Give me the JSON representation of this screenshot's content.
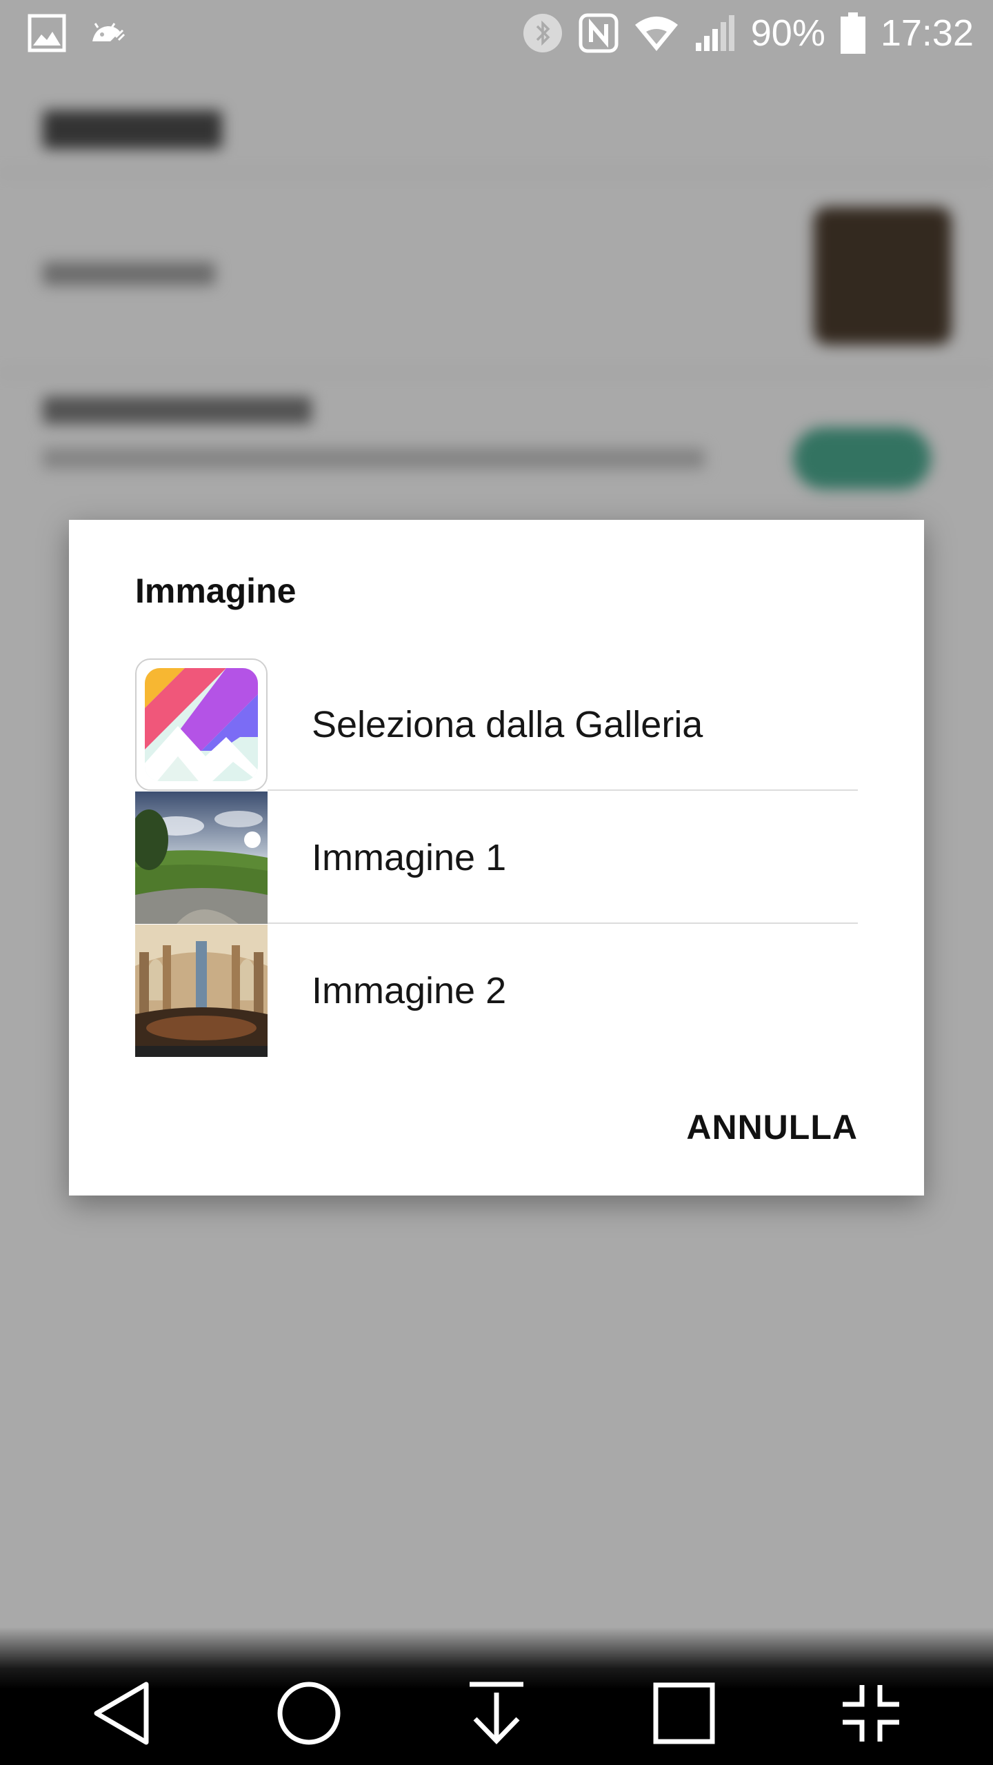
{
  "status_bar": {
    "battery_text": "90%",
    "time": "17:32",
    "left_icons": [
      "image-notification-icon",
      "android-debug-icon"
    ],
    "right_icons": [
      "bluetooth-icon",
      "nfc-icon",
      "wifi-icon",
      "signal-icon",
      "battery-icon"
    ]
  },
  "dialog": {
    "title": "Immagine",
    "items": [
      {
        "label": "Seleziona dalla Galleria",
        "icon": "gallery-app-icon"
      },
      {
        "label": "Immagine 1",
        "icon": "panorama-landscape-thumbnail"
      },
      {
        "label": "Immagine 2",
        "icon": "panorama-church-thumbnail"
      }
    ],
    "cancel_label": "ANNULLA"
  },
  "nav_bar": {
    "buttons": [
      "back-icon",
      "home-icon",
      "notification-pull-icon",
      "recents-icon",
      "exit-fullscreen-icon"
    ]
  }
}
